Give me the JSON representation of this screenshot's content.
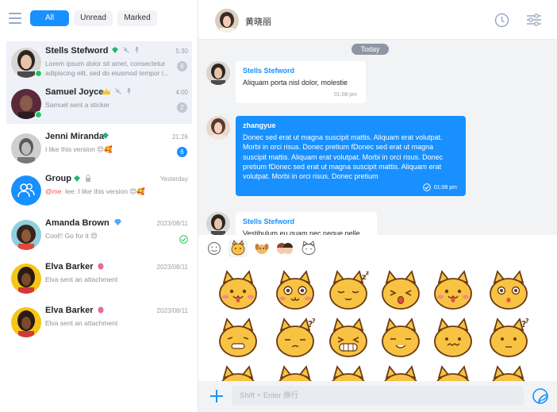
{
  "filters": {
    "all": "All",
    "unread": "Unread",
    "marked": "Marked"
  },
  "conversations": [
    {
      "name": "Stells Stefword",
      "time": "5:30",
      "message": "Lorem ipsum dolor sit amet, consectetur adipiscing elit, sed do eiusmod tempor i...",
      "count": "6"
    },
    {
      "name": "Samuel Joyce",
      "time": "4:00",
      "message": "Samuel sent a sticker",
      "count": "2"
    },
    {
      "name": "Jenni Miranda",
      "time": "21:26",
      "message": "I like this version 😍🥰",
      "count": "6"
    },
    {
      "name": "Group",
      "time": "Yesterday",
      "me_tag": "@me",
      "message": "lee: I like this version 😍🥰"
    },
    {
      "name": "Amanda Brown",
      "time": "2023/08/11",
      "message": "Cool!! Go for it 😍"
    },
    {
      "name": "Elva Barker",
      "time": "2023/08/11",
      "message": "Elva sent an attachment"
    },
    {
      "name": "Elva Barker",
      "time": "2023/08/11",
      "message": "Elva sent an attachment"
    }
  ],
  "header": {
    "title": "黄晓丽"
  },
  "chat": {
    "date_divider": "Today",
    "messages": [
      {
        "sender": "Stells Stefword",
        "text": "Aliquam porta nisl dolor, molestie",
        "time": "01:08 pm"
      },
      {
        "sender": "zhangyue",
        "lines": [
          "Donec sed erat ut magna suscipit mattis. Aliquam erat volutpat.",
          "Morbi in orci risus. Donec pretium fDonec sed erat ut magna",
          "suscipit mattis. Aliquam erat volutpat. Morbi in orci risus. Donec",
          "pretium fDonec sed erat ut magna suscipit mattis. Aliquam erat",
          "volutpat. Morbi in orci risus. Donec pretium"
        ],
        "time": "01:08 pm"
      },
      {
        "sender": "Stells Stefword",
        "text": "Vestibulum eu quam nec neque pelle"
      }
    ]
  },
  "input": {
    "placeholder": "Shift + Enter 换行"
  },
  "colors": {
    "accent": "#1890ff",
    "panel_bg": "#f2f3f5",
    "online": "#22c55e"
  }
}
